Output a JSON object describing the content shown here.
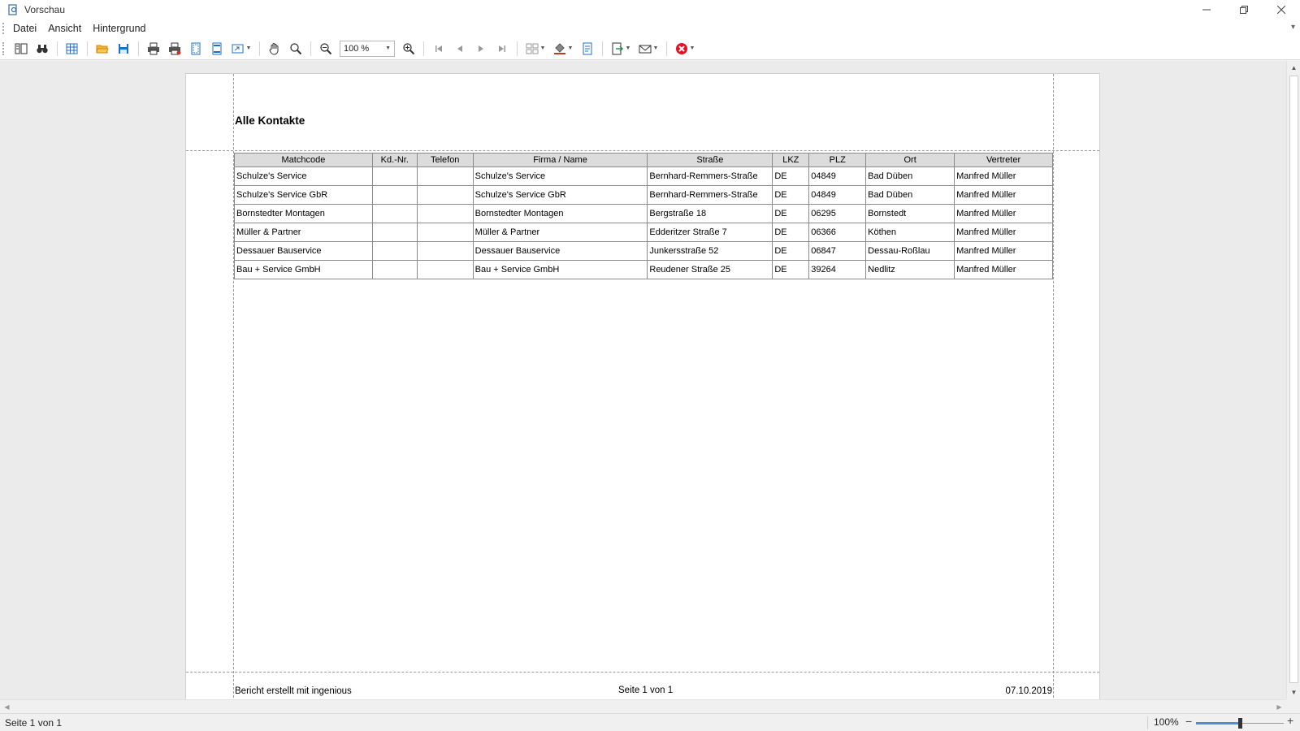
{
  "window": {
    "title": "Vorschau"
  },
  "menu": {
    "items": [
      "Datei",
      "Ansicht",
      "Hintergrund"
    ]
  },
  "toolbar": {
    "zoom_value": "100 %",
    "icons": [
      "thumbnails-icon",
      "find-icon",
      "parameters-icon",
      "open-icon",
      "save-icon",
      "print-icon",
      "quick-print-icon",
      "page-setup-icon",
      "header-footer-icon",
      "scale-icon",
      "hand-tool-icon",
      "magnifier-icon",
      "zoom-out-icon",
      "zoom-in-icon",
      "first-page-icon",
      "previous-page-icon",
      "next-page-icon",
      "last-page-icon",
      "multiple-pages-icon",
      "background-color-icon",
      "watermark-icon",
      "export-icon",
      "send-email-icon",
      "close-preview-icon"
    ]
  },
  "report": {
    "title": "Alle Kontakte",
    "columns": [
      "Matchcode",
      "Kd.-Nr.",
      "Telefon",
      "Firma / Name",
      "Straße",
      "LKZ",
      "PLZ",
      "Ort",
      "Vertreter"
    ],
    "rows": [
      [
        "Schulze's Service",
        "",
        "",
        "Schulze's Service",
        "Bernhard-Remmers-Straße",
        "DE",
        "04849",
        "Bad Düben",
        "Manfred Müller"
      ],
      [
        "Schulze's Service GbR",
        "",
        "",
        "Schulze's Service GbR",
        "Bernhard-Remmers-Straße",
        "DE",
        "04849",
        "Bad Düben",
        "Manfred Müller"
      ],
      [
        "Bornstedter Montagen",
        "",
        "",
        "Bornstedter Montagen",
        "Bergstraße 18",
        "DE",
        "06295",
        "Bornstedt",
        "Manfred Müller"
      ],
      [
        "Müller & Partner",
        "",
        "",
        "Müller & Partner",
        "Edderitzer Straße 7",
        "DE",
        "06366",
        "Köthen",
        "Manfred Müller"
      ],
      [
        "Dessauer Bauservice",
        "",
        "",
        "Dessauer Bauservice",
        "Junkersstraße 52",
        "DE",
        "06847",
        "Dessau-Roßlau",
        "Manfred Müller"
      ],
      [
        "Bau + Service GmbH",
        "",
        "",
        "Bau + Service GmbH",
        "Reudener Straße 25",
        "DE",
        "39264",
        "Nedlitz",
        "Manfred Müller"
      ]
    ],
    "footer_left": "Bericht erstellt mit ingenious",
    "footer_center": "Seite 1 von 1",
    "footer_right": "07.10.2019"
  },
  "status": {
    "page_status": "Seite 1 von 1",
    "zoom_percent": "100%",
    "zoom_level": 0.5
  },
  "colors": {
    "accent": "#1e6fc8",
    "close_red": "#e81123",
    "header_gray": "#dcdcdc"
  }
}
